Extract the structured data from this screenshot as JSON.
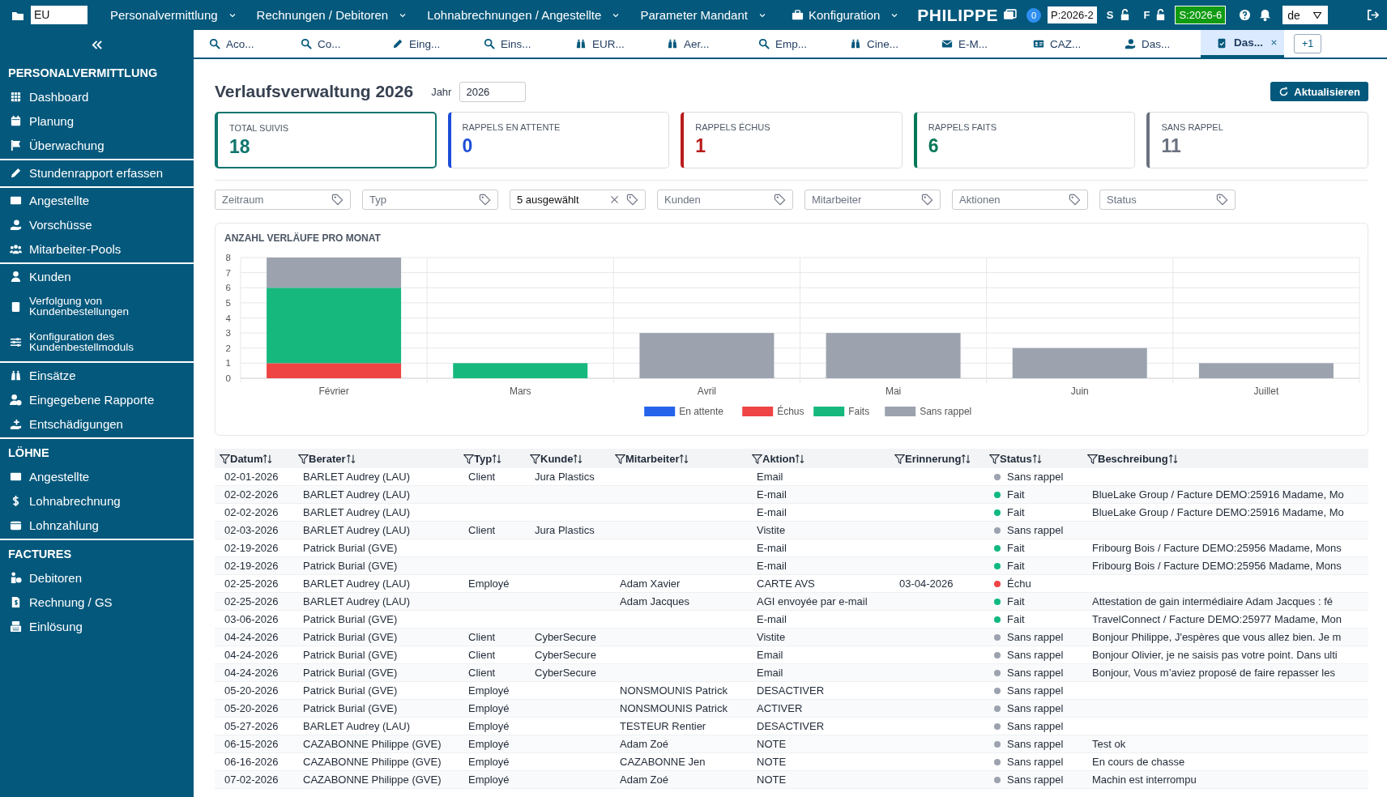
{
  "topbar": {
    "tenant": "EU",
    "menus": [
      {
        "label": "Personalvermittlung"
      },
      {
        "label": "Rechnungen / Debitoren"
      },
      {
        "label": "Lohnabrechnungen / Angestellte"
      },
      {
        "label": "Parameter Mandant"
      },
      {
        "label": "Konfiguration"
      }
    ],
    "user": "PHILIPPE",
    "notification_count": "0",
    "period_p": "P:2026-2",
    "s_label": "S",
    "f_label": "F",
    "period_s": "S:2026-6",
    "language": "de"
  },
  "tabs": [
    {
      "label": "Aco...",
      "selected": false
    },
    {
      "label": "Co...",
      "selected": false
    },
    {
      "label": "Eing...",
      "selected": false
    },
    {
      "label": "Eins...",
      "selected": false
    },
    {
      "label": "EUR...",
      "selected": false
    },
    {
      "label": "Aer...",
      "selected": false
    },
    {
      "label": "Emp...",
      "selected": false
    },
    {
      "label": "Cine...",
      "selected": false
    },
    {
      "label": "E-M...",
      "selected": false
    },
    {
      "label": "CAZ...",
      "selected": false
    },
    {
      "label": "Das...",
      "selected": false
    },
    {
      "label": "Das...",
      "selected": true
    }
  ],
  "more_tabs": "+1",
  "sidebar": {
    "groups": [
      {
        "heading": "PERSONALVERMITTLUNG",
        "items": [
          {
            "label": "Dashboard"
          },
          {
            "label": "Planung"
          },
          {
            "label": "Überwachung"
          }
        ]
      },
      {
        "items": [
          {
            "label": "Stundenrapport erfassen"
          }
        ]
      },
      {
        "items": [
          {
            "label": "Angestellte"
          },
          {
            "label": "Vorschüsse"
          },
          {
            "label": "Mitarbeiter-Pools"
          }
        ]
      },
      {
        "items": [
          {
            "label": "Kunden"
          },
          {
            "label": "Verfolgung von Kundenbestellungen"
          },
          {
            "label": "Konfiguration des Kundenbestellmoduls"
          }
        ]
      },
      {
        "items": [
          {
            "label": "Einsätze"
          },
          {
            "label": "Eingegebene Rapporte"
          },
          {
            "label": "Entschädigungen"
          }
        ]
      },
      {
        "heading": "LÖHNE",
        "items": [
          {
            "label": "Angestellte"
          },
          {
            "label": "Lohnabrechnung"
          },
          {
            "label": "Lohnzahlung"
          }
        ]
      },
      {
        "heading": "FACTURES",
        "items": [
          {
            "label": "Debitoren"
          },
          {
            "label": "Rechnung / GS"
          },
          {
            "label": "Einlösung"
          }
        ]
      }
    ]
  },
  "page": {
    "title": "Verlaufsverwaltung 2026",
    "year_label": "Jahr",
    "year": "2026",
    "refresh_button": "Aktualisieren"
  },
  "kpis": [
    {
      "label": "TOTAL SUIVIS",
      "value": "18",
      "color": "#0f766e",
      "selected": true
    },
    {
      "label": "RAPPELS EN ATTENTE",
      "value": "0",
      "color": "#1d4ed8",
      "selected": false
    },
    {
      "label": "RAPPELS ÉCHUS",
      "value": "1",
      "color": "#b91c1c",
      "selected": false
    },
    {
      "label": "RAPPELS FAITS",
      "value": "6",
      "color": "#047857",
      "selected": false
    },
    {
      "label": "SANS RAPPEL",
      "value": "11",
      "color": "#6b7280",
      "selected": false
    }
  ],
  "filters": [
    {
      "placeholder": "Zeitraum"
    },
    {
      "placeholder": "Typ"
    },
    {
      "value": "5 ausgewählt"
    },
    {
      "placeholder": "Kunden"
    },
    {
      "placeholder": "Mitarbeiter"
    },
    {
      "placeholder": "Aktionen"
    },
    {
      "placeholder": "Status"
    }
  ],
  "chart": {
    "chart_data": {
      "type": "bar",
      "title": "ANZAHL VERLÄUFE PRO MONAT",
      "stacked": true,
      "grid": true,
      "legend": true,
      "categories": [
        "Février",
        "Mars",
        "Avril",
        "Mai",
        "Juin",
        "Juillet"
      ],
      "ylim": [
        0,
        8
      ],
      "yticks": [
        0,
        1,
        2,
        3,
        4,
        5,
        6,
        7,
        8
      ],
      "series": [
        {
          "name": "En attente",
          "color": "#2563eb",
          "values": [
            0,
            0,
            0,
            0,
            0,
            0
          ]
        },
        {
          "name": "Échus",
          "color": "#ef4444",
          "values": [
            1,
            0,
            0,
            0,
            0,
            0
          ]
        },
        {
          "name": "Faits",
          "color": "#16b87e",
          "values": [
            5,
            1,
            0,
            0,
            0,
            0
          ]
        },
        {
          "name": "Sans rappel",
          "color": "#9ca3af",
          "values": [
            2,
            0,
            3,
            3,
            2,
            1
          ]
        }
      ]
    }
  },
  "table": {
    "columns": [
      "Datum",
      "Berater",
      "Typ",
      "Kunde",
      "Mitarbeiter",
      "Aktion",
      "Erinnerung",
      "Status",
      "Beschreibung"
    ],
    "rows": [
      {
        "datum": "02-01-2026",
        "berater": "BARLET Audrey (LAU)",
        "typ": "Client",
        "kunde": "Jura Plastics",
        "aktion": "Email",
        "status": "Sans rappel",
        "color": "#9ca3af"
      },
      {
        "datum": "02-02-2026",
        "berater": "BARLET Audrey (LAU)",
        "aktion": "E-mail",
        "status": "Fait",
        "color": "#10b981",
        "beschreibung": "BlueLake Group / Facture DEMO:25916 Madame, Mo"
      },
      {
        "datum": "02-02-2026",
        "berater": "BARLET Audrey (LAU)",
        "aktion": "E-mail",
        "status": "Fait",
        "color": "#10b981",
        "beschreibung": "BlueLake Group / Facture DEMO:25916 Madame, Mo"
      },
      {
        "datum": "02-03-2026",
        "berater": "BARLET Audrey (LAU)",
        "typ": "Client",
        "kunde": "Jura Plastics",
        "aktion": "Vistite",
        "status": "Sans rappel",
        "color": "#9ca3af"
      },
      {
        "datum": "02-19-2026",
        "berater": "Patrick Burial (GVE)",
        "aktion": "E-mail",
        "status": "Fait",
        "color": "#10b981",
        "beschreibung": "Fribourg Bois / Facture DEMO:25956 Madame, Mons"
      },
      {
        "datum": "02-19-2026",
        "berater": "Patrick Burial (GVE)",
        "aktion": "E-mail",
        "status": "Fait",
        "color": "#10b981",
        "beschreibung": "Fribourg Bois / Facture DEMO:25956 Madame, Mons"
      },
      {
        "datum": "02-25-2026",
        "berater": "BARLET Audrey (LAU)",
        "typ": "Employé",
        "mitarbeiter": "Adam Xavier",
        "aktion": "CARTE AVS",
        "erinnerung": "03-04-2026",
        "status": "Échu",
        "color": "#ef4444"
      },
      {
        "datum": "02-25-2026",
        "berater": "BARLET Audrey (LAU)",
        "mitarbeiter": "Adam Jacques",
        "aktion": "AGI envoyée par e-mail",
        "status": "Fait",
        "color": "#10b981",
        "beschreibung": "Attestation de gain intermédiaire Adam Jacques : fé"
      },
      {
        "datum": "03-06-2026",
        "berater": "Patrick Burial (GVE)",
        "aktion": "E-mail",
        "status": "Fait",
        "color": "#10b981",
        "beschreibung": "TravelConnect / Facture DEMO:25977 Madame, Mon"
      },
      {
        "datum": "04-24-2026",
        "berater": "Patrick Burial (GVE)",
        "typ": "Client",
        "kunde": "CyberSecure",
        "aktion": "Vistite",
        "status": "Sans rappel",
        "color": "#9ca3af",
        "beschreibung": "Bonjour Philippe, J'espères que vous allez bien. Je m"
      },
      {
        "datum": "04-24-2026",
        "berater": "Patrick Burial (GVE)",
        "typ": "Client",
        "kunde": "CyberSecure",
        "aktion": "Email",
        "status": "Sans rappel",
        "color": "#9ca3af",
        "beschreibung": "Bonjour Olivier, je ne saisis pas votre point. Dans ulti"
      },
      {
        "datum": "04-24-2026",
        "berater": "Patrick Burial (GVE)",
        "typ": "Client",
        "kunde": "CyberSecure",
        "aktion": "Email",
        "status": "Sans rappel",
        "color": "#9ca3af",
        "beschreibung": "Bonjour, Vous m’aviez proposé de faire repasser les"
      },
      {
        "datum": "05-20-2026",
        "berater": "Patrick Burial (GVE)",
        "typ": "Employé",
        "mitarbeiter": "NONSMOUNIS Patrick",
        "aktion": "DESACTIVER",
        "status": "Sans rappel",
        "color": "#9ca3af"
      },
      {
        "datum": "05-20-2026",
        "berater": "Patrick Burial (GVE)",
        "typ": "Employé",
        "mitarbeiter": "NONSMOUNIS Patrick",
        "aktion": "ACTIVER",
        "status": "Sans rappel",
        "color": "#9ca3af"
      },
      {
        "datum": "05-27-2026",
        "berater": "BARLET Audrey (LAU)",
        "typ": "Employé",
        "mitarbeiter": "TESTEUR Rentier",
        "aktion": "DESACTIVER",
        "status": "Sans rappel",
        "color": "#9ca3af"
      },
      {
        "datum": "06-15-2026",
        "berater": "CAZABONNE Philippe (GVE)",
        "typ": "Employé",
        "mitarbeiter": "Adam Zoé",
        "aktion": "NOTE",
        "status": "Sans rappel",
        "color": "#9ca3af",
        "beschreibung": "Test ok"
      },
      {
        "datum": "06-16-2026",
        "berater": "CAZABONNE Philippe (GVE)",
        "typ": "Employé",
        "mitarbeiter": "CAZABONNE Jen",
        "aktion": "NOTE",
        "status": "Sans rappel",
        "color": "#9ca3af",
        "beschreibung": "En cours de chasse"
      },
      {
        "datum": "07-02-2026",
        "berater": "CAZABONNE Philippe (GVE)",
        "typ": "Employé",
        "mitarbeiter": "Adam Zoé",
        "aktion": "NOTE",
        "status": "Sans rappel",
        "color": "#9ca3af",
        "beschreibung": "Machin est interrompu"
      }
    ]
  }
}
